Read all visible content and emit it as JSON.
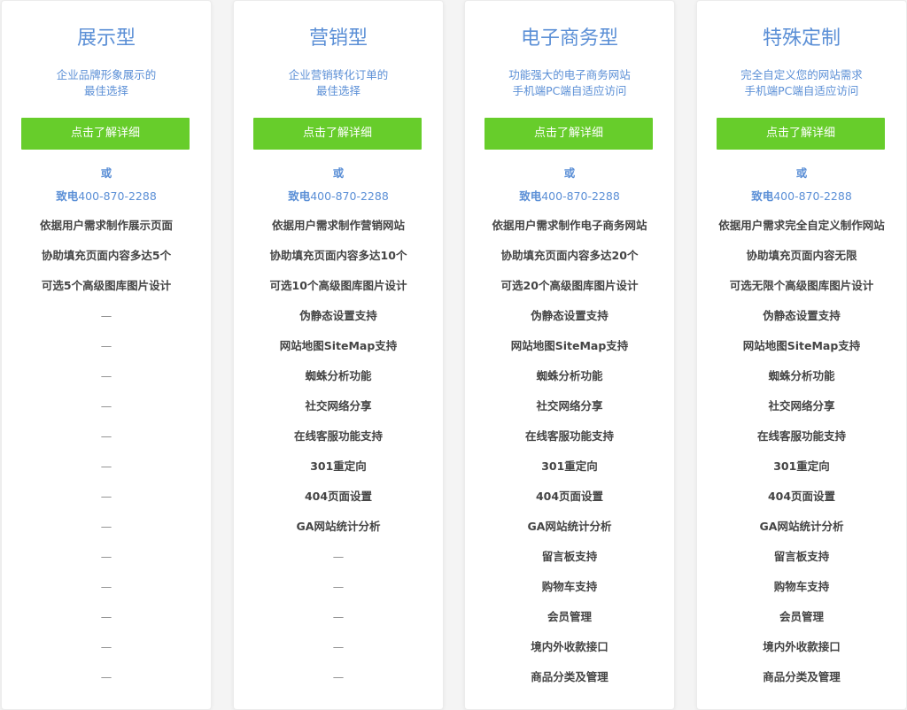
{
  "plans": [
    {
      "title": "展示型",
      "desc": [
        "企业品牌形象展示的",
        "最佳选择"
      ],
      "button": "点击了解详细",
      "or": "或",
      "phone_prefix": "致电",
      "phone_number": "400-870-2288",
      "features": [
        "依据用户需求制作展示页面",
        "协助填充页面内容多达5个",
        "可选5个高级图库图片设计",
        "—",
        "—",
        "—",
        "—",
        "—",
        "—",
        "—",
        "—",
        "—",
        "—",
        "—",
        "—",
        "—"
      ]
    },
    {
      "title": "营销型",
      "desc": [
        "企业营销转化订单的",
        "最佳选择"
      ],
      "button": "点击了解详细",
      "or": "或",
      "phone_prefix": "致电",
      "phone_number": "400-870-2288",
      "features": [
        "依据用户需求制作营销网站",
        "协助填充页面内容多达10个",
        "可选10个高级图库图片设计",
        "伪静态设置支持",
        "网站地图SiteMap支持",
        "蜘蛛分析功能",
        "社交网络分享",
        "在线客服功能支持",
        "301重定向",
        "404页面设置",
        "GA网站统计分析",
        "—",
        "—",
        "—",
        "—",
        "—"
      ]
    },
    {
      "title": "电子商务型",
      "desc": [
        "功能强大的电子商务网站",
        "手机端PC端自适应访问"
      ],
      "button": "点击了解详细",
      "or": "或",
      "phone_prefix": "致电",
      "phone_number": "400-870-2288",
      "features": [
        "依据用户需求制作电子商务网站",
        "协助填充页面内容多达20个",
        "可选20个高级图库图片设计",
        "伪静态设置支持",
        "网站地图SiteMap支持",
        "蜘蛛分析功能",
        "社交网络分享",
        "在线客服功能支持",
        "301重定向",
        "404页面设置",
        "GA网站统计分析",
        "留言板支持",
        "购物车支持",
        "会员管理",
        "境内外收款接口",
        "商品分类及管理"
      ]
    },
    {
      "title": "特殊定制",
      "desc": [
        "完全自定义您的网站需求",
        "手机端PC端自适应访问"
      ],
      "button": "点击了解详细",
      "or": "或",
      "phone_prefix": "致电",
      "phone_number": "400-870-2288",
      "features": [
        "依据用户需求完全自定义制作网站",
        "协助填充页面内容无限",
        "可选无限个高级图库图片设计",
        "伪静态设置支持",
        "网站地图SiteMap支持",
        "蜘蛛分析功能",
        "社交网络分享",
        "在线客服功能支持",
        "301重定向",
        "404页面设置",
        "GA网站统计分析",
        "留言板支持",
        "购物车支持",
        "会员管理",
        "境内外收款接口",
        "商品分类及管理"
      ]
    }
  ],
  "colors": {
    "accent_blue": "#5b8fd6",
    "button_green": "#67cd2b",
    "feature_text": "#444444",
    "dash_text": "#888888"
  }
}
